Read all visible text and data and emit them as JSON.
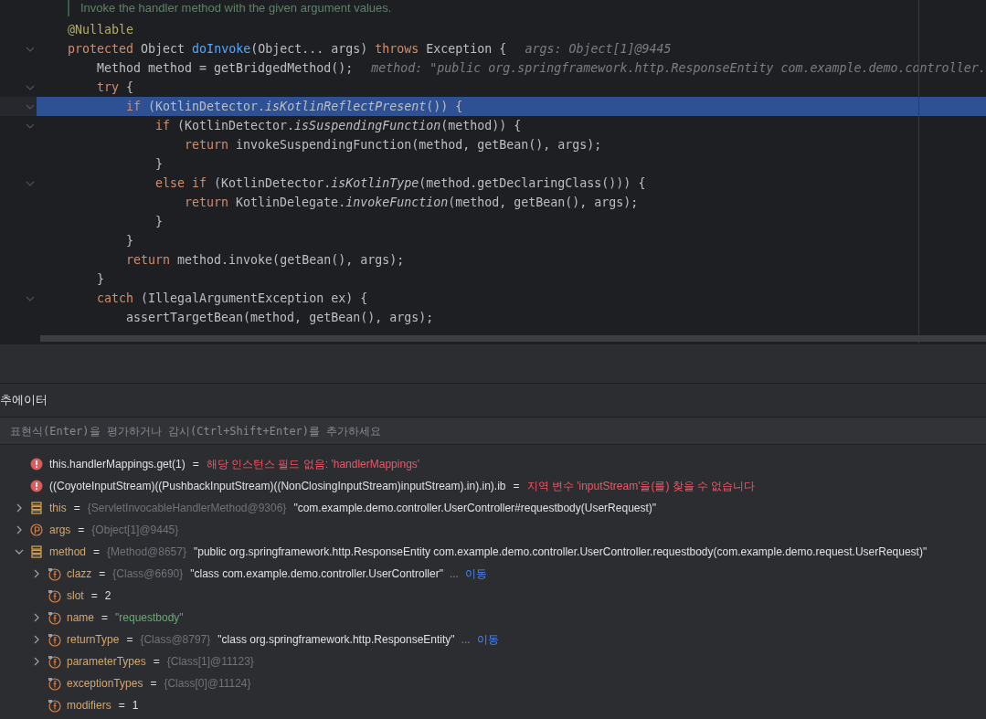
{
  "editor": {
    "doc_comment": "Invoke the handler method with the given argument values.",
    "lines": [
      {
        "foldable": false,
        "selected": false,
        "tokens": [
          {
            "kind": "annotation",
            "text": "@Nullable"
          }
        ]
      },
      {
        "foldable": true,
        "selected": false,
        "tokens": [
          {
            "kind": "keyword",
            "text": "protected"
          },
          {
            "kind": "plain",
            "text": " Object "
          },
          {
            "kind": "declaration",
            "text": "doInvoke"
          },
          {
            "kind": "plain",
            "text": "(Object... args) "
          },
          {
            "kind": "keyword",
            "text": "throws"
          },
          {
            "kind": "plain",
            "text": " Exception {"
          },
          {
            "kind": "hint",
            "text": "args: Object[1]@9445"
          }
        ],
        "children": [
          {
            "foldable": false,
            "selected": false,
            "tokens": [
              {
                "kind": "plain",
                "text": "Method method = getBridgedMethod();"
              },
              {
                "kind": "hint",
                "text": "method: \"public org.springframework.http.ResponseEntity com.example.demo.controller."
              }
            ]
          },
          {
            "foldable": true,
            "selected": false,
            "tokens": [
              {
                "kind": "keyword",
                "text": "try"
              },
              {
                "kind": "plain",
                "text": " {"
              }
            ],
            "children": [
              {
                "foldable": true,
                "selected": true,
                "tokens": [
                  {
                    "kind": "keyword",
                    "text": "if"
                  },
                  {
                    "kind": "plain",
                    "text": " (KotlinDetector."
                  },
                  {
                    "kind": "static",
                    "text": "isKotlinReflectPresent"
                  },
                  {
                    "kind": "plain",
                    "text": "()) {"
                  }
                ],
                "children": [
                  {
                    "foldable": true,
                    "selected": false,
                    "tokens": [
                      {
                        "kind": "keyword",
                        "text": "if"
                      },
                      {
                        "kind": "plain",
                        "text": " (KotlinDetector."
                      },
                      {
                        "kind": "static",
                        "text": "isSuspendingFunction"
                      },
                      {
                        "kind": "plain",
                        "text": "(method)) {"
                      }
                    ],
                    "children": [
                      {
                        "foldable": false,
                        "selected": false,
                        "tokens": [
                          {
                            "kind": "keyword",
                            "text": "return"
                          },
                          {
                            "kind": "plain",
                            "text": " invokeSuspendingFunction(method, getBean(), args);"
                          }
                        ]
                      }
                    ]
                  },
                  {
                    "foldable": false,
                    "selected": false,
                    "tokens": [
                      {
                        "kind": "plain",
                        "text": "}"
                      }
                    ]
                  },
                  {
                    "foldable": true,
                    "selected": false,
                    "tokens": [
                      {
                        "kind": "keyword",
                        "text": "else if"
                      },
                      {
                        "kind": "plain",
                        "text": " (KotlinDetector."
                      },
                      {
                        "kind": "static",
                        "text": "isKotlinType"
                      },
                      {
                        "kind": "plain",
                        "text": "(method.getDeclaringClass())) {"
                      }
                    ],
                    "children": [
                      {
                        "foldable": false,
                        "selected": false,
                        "tokens": [
                          {
                            "kind": "keyword",
                            "text": "return"
                          },
                          {
                            "kind": "plain",
                            "text": " KotlinDelegate."
                          },
                          {
                            "kind": "static",
                            "text": "invokeFunction"
                          },
                          {
                            "kind": "plain",
                            "text": "(method, getBean(), args);"
                          }
                        ]
                      }
                    ]
                  },
                  {
                    "foldable": false,
                    "selected": false,
                    "tokens": [
                      {
                        "kind": "plain",
                        "text": "}"
                      }
                    ]
                  }
                ]
              },
              {
                "foldable": false,
                "selected": false,
                "tokens": [
                  {
                    "kind": "plain",
                    "text": "}"
                  }
                ]
              },
              {
                "foldable": false,
                "selected": false,
                "tokens": [
                  {
                    "kind": "keyword",
                    "text": "return"
                  },
                  {
                    "kind": "plain",
                    "text": " method.invoke(getBean(), args);"
                  }
                ]
              }
            ]
          },
          {
            "foldable": false,
            "selected": false,
            "tokens": [
              {
                "kind": "plain",
                "text": "}"
              }
            ]
          },
          {
            "foldable": true,
            "selected": false,
            "tokens": [
              {
                "kind": "keyword",
                "text": "catch"
              },
              {
                "kind": "plain",
                "text": " (IllegalArgumentException ex) {"
              }
            ],
            "children": [
              {
                "foldable": false,
                "selected": false,
                "tokens": [
                  {
                    "kind": "plain",
                    "text": "assertTargetBean(method, getBean(), args);"
                  }
                ]
              }
            ]
          }
        ]
      }
    ]
  },
  "debug_panel": {
    "title": "추에이터",
    "evaluate_field": {
      "placeholder": "표현식(Enter)을 평가하거나 감시(Ctrl+Shift+Enter)를 추가하세요"
    },
    "tree": [
      {
        "kind": "error",
        "name": "this.handlerMappings.get(1)",
        "operator": "=",
        "message": "해당 인스턴스 필드 없음: 'handlerMappings'"
      },
      {
        "kind": "error",
        "name": "((CoyoteInputStream)((PushbackInputStream)((NonClosingInputStream)inputStream).in).in).ib",
        "operator": "=",
        "message": "지역 변수 'inputStream'을(를) 찾을 수 없습니다"
      },
      {
        "kind": "object",
        "expandable": true,
        "expanded": false,
        "name": "this",
        "operator": "=",
        "type": "{ServletInvocableHandlerMethod@9306}",
        "value": "\"com.example.demo.controller.UserController#requestbody(UserRequest)\"",
        "string_value": false
      },
      {
        "kind": "param",
        "expandable": true,
        "expanded": false,
        "name": "args",
        "operator": "=",
        "type": "{Object[1]@9445}"
      },
      {
        "kind": "object",
        "expandable": true,
        "expanded": true,
        "name": "method",
        "operator": "=",
        "type": "{Method@8657}",
        "value": "\"public org.springframework.http.ResponseEntity com.example.demo.controller.UserController.requestbody(com.example.demo.request.UserRequest)\"",
        "string_value": false,
        "children": [
          {
            "kind": "field",
            "expandable": true,
            "expanded": false,
            "name": "clazz",
            "operator": "=",
            "type": "{Class@6690}",
            "value": "\"class com.example.demo.controller.UserController\"",
            "string_value": false,
            "ellipsis": "...",
            "link": "이동"
          },
          {
            "kind": "field",
            "expandable": false,
            "name": "slot",
            "operator": "=",
            "value": "2",
            "string_value": false
          },
          {
            "kind": "field",
            "expandable": true,
            "expanded": false,
            "name": "name",
            "operator": "=",
            "value": "\"requestbody\"",
            "string_value": true
          },
          {
            "kind": "field",
            "expandable": true,
            "expanded": false,
            "name": "returnType",
            "operator": "=",
            "type": "{Class@8797}",
            "value": "\"class org.springframework.http.ResponseEntity\"",
            "string_value": false,
            "ellipsis": "...",
            "link": "이동"
          },
          {
            "kind": "field",
            "expandable": true,
            "expanded": false,
            "name": "parameterTypes",
            "operator": "=",
            "type": "{Class[1]@11123}"
          },
          {
            "kind": "field",
            "expandable": false,
            "name": "exceptionTypes",
            "operator": "=",
            "type": "{Class[0]@11124}"
          },
          {
            "kind": "field",
            "expandable": false,
            "name": "modifiers",
            "operator": "=",
            "value": "1",
            "string_value": false
          }
        ]
      }
    ]
  }
}
